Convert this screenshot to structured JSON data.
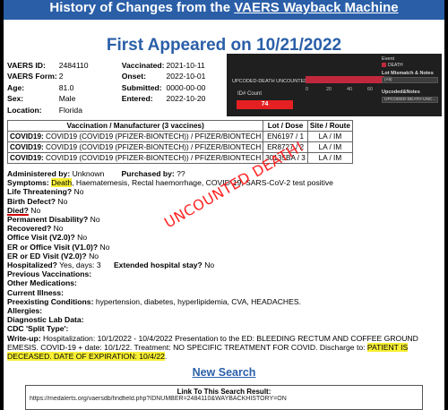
{
  "header": {
    "banner_prefix": "History of Changes from the ",
    "banner_link": "VAERS Wayback Machine",
    "first_appeared": "First Appeared on 10/21/2022"
  },
  "meta": {
    "vaers_id_label": "VAERS ID:",
    "vaers_id": "2484110",
    "form_label": "VAERS Form:",
    "form": "2",
    "age_label": "Age:",
    "age": "81.0",
    "sex_label": "Sex:",
    "sex": "Male",
    "location_label": "Location:",
    "location": "Florida",
    "vaccinated_label": "Vaccinated:",
    "vaccinated": "2021-10-11",
    "onset_label": "Onset:",
    "onset": "2022-10-01",
    "submitted_label": "Submitted:",
    "submitted": "0000-00-00",
    "entered_label": "Entered:",
    "entered": "2022-10-20"
  },
  "dashboard": {
    "row_label": "UPCODED-DEATH UNCOUNTED",
    "axis_ticks": [
      "0",
      "20",
      "40",
      "60"
    ],
    "bar_fraction": 0.92,
    "count_label": "ID# Count",
    "count_value": "74",
    "legend_title": "Event",
    "legend_item": "DEATH",
    "filter1_label": "Lot Mismatch & Notes",
    "filter1_value": "(All)",
    "filter2_label": "Upcoded&Notes",
    "filter2_value": "UPCODED-DEATH-UNC...",
    "bar_color": "#c2283d",
    "count_color": "#e52022"
  },
  "vaccines": {
    "header_name": "Vaccination / Manufacturer (3 vaccines)",
    "header_lot": "Lot / Dose",
    "header_site": "Site / Route",
    "rows": [
      {
        "type": "COVID19:",
        "name": "COVID19 (COVID19 (PFIZER-BIONTECH)) / PFIZER/BIONTECH",
        "lot": "EN6197 / 1",
        "site": "LA / IM"
      },
      {
        "type": "COVID19:",
        "name": "COVID19 (COVID19 (PFIZER-BIONTECH)) / PFIZER/BIONTECH",
        "lot": "ER8727 / 2",
        "site": "LA / IM"
      },
      {
        "type": "COVID19:",
        "name": "COVID19 (COVID19 (PFIZER-BIONTECH)) / PFIZER/BIONTECH",
        "lot": "30135BA / 3",
        "site": "LA / IM"
      }
    ]
  },
  "details": {
    "administered_label": "Administered by:",
    "administered": "Unknown",
    "purchased_label": "Purchased by:",
    "purchased": "??",
    "symptoms_label": "Symptoms:",
    "symptoms_death": "Death",
    "symptoms_rest": ", Haematemesis, Rectal haemorrhage, COVID-19, SARS-CoV-2 test positive",
    "life_label": "Life Threatening?",
    "life": "No",
    "birth_label": "Birth Defect?",
    "birth": "No",
    "died_label": "Died?",
    "died": "No",
    "perm_label": "Permanent Disability?",
    "perm": "No",
    "recovered_label": "Recovered?",
    "recovered": "No",
    "office_label": "Office Visit (V2.0)?",
    "office": "No",
    "er_label": "ER or Office Visit (V1.0)?",
    "er": "No",
    "ered_label": "ER or ED Visit (V2.0)?",
    "ered": "No",
    "hosp_label": "Hospitalized?",
    "hosp": "Yes, days: 3",
    "ext_label": "Extended hospital stay?",
    "ext": "No",
    "prev_label": "Previous Vaccinations:",
    "other_label": "Other Medications:",
    "illness_label": "Current Illness:",
    "pre_label": "Preexisting Conditions:",
    "pre": "hypertension, diabetes, hyperlipidemia, CVA, HEADACHES.",
    "allergies_label": "Allergies:",
    "lab_label": "Diagnostic Lab Data:",
    "cdc_label": "CDC 'Split Type':",
    "writeup_label": "Write-up:",
    "writeup": "Hospitalization: 10/1/2022 - 10/4/2022 Presentation to the ED: BLEEDING RECTUM AND COFFEE GROUND EMESIS. COVID-19 + date: 10/1/22. Treatment: NO SPECIFIC TREATMENT FOR COVID. Discharge to: ",
    "writeup_hl": "PATIENT IS DECEASED. DATE OF EXPIRATION: 10/4/22",
    "writeup_end": "."
  },
  "annotation": {
    "stamp": "UNCOUNTED DEATH!",
    "color": "#ff2424"
  },
  "footer": {
    "new_search": "New Search",
    "link_title": "Link To This Search Result:",
    "link_url": "https://medalerts.org/vaersdb/findfield.php?IDNUMBER=2484110&WAYBACKHISTORY=ON"
  }
}
